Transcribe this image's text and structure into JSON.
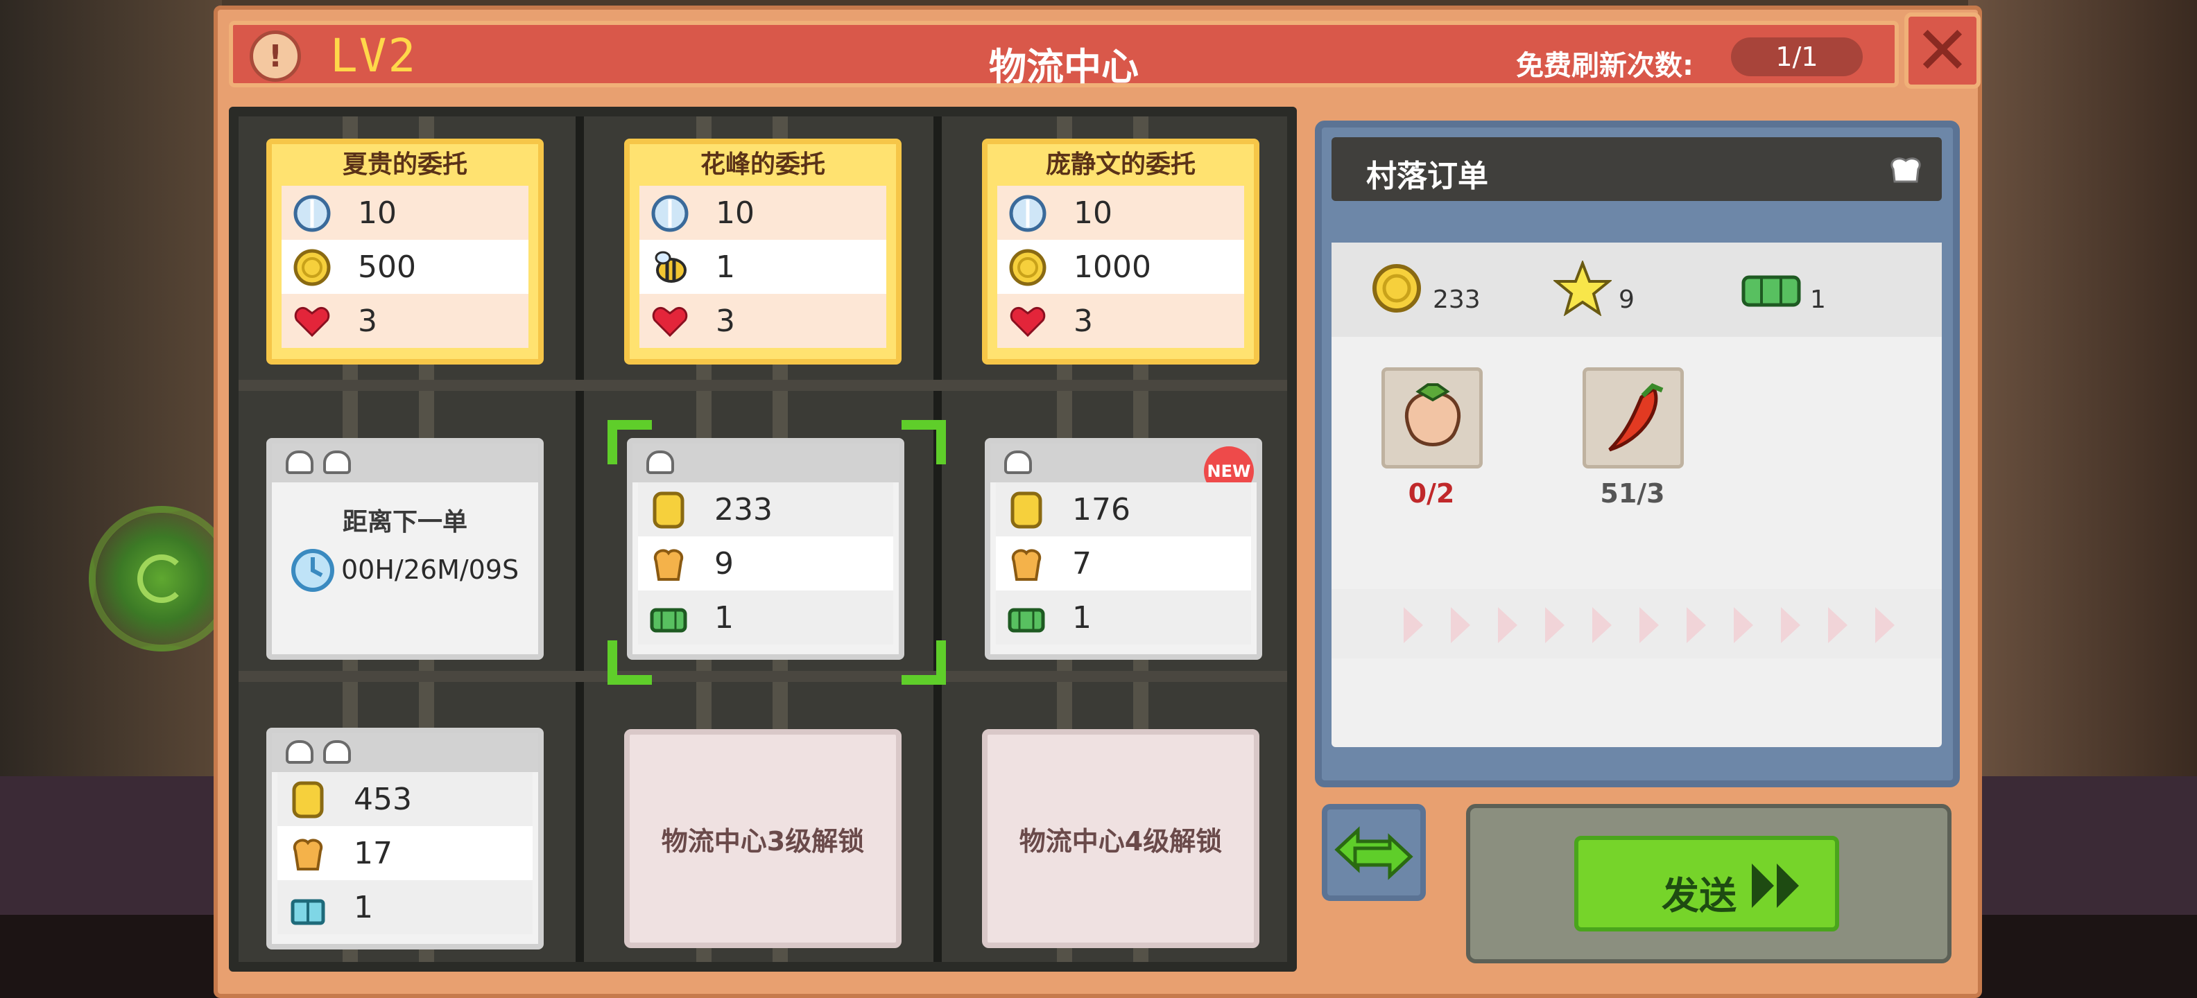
{
  "header": {
    "level": "LV2",
    "title": "物流中心",
    "refresh_label": "免费刷新次数:",
    "refresh_value": "1/1",
    "close_icon": "close-icon",
    "help_icon": "keyhole-icon"
  },
  "commissions": [
    {
      "name": "夏贵的委托",
      "rows": [
        {
          "icon": "crystal-icon",
          "value": "10"
        },
        {
          "icon": "coin-icon",
          "value": "500"
        },
        {
          "icon": "heart-icon",
          "value": "3"
        }
      ]
    },
    {
      "name": "花峰的委托",
      "rows": [
        {
          "icon": "crystal-icon",
          "value": "10"
        },
        {
          "icon": "bee-icon",
          "value": "1"
        },
        {
          "icon": "heart-icon",
          "value": "3"
        }
      ]
    },
    {
      "name": "庞静文的委托",
      "rows": [
        {
          "icon": "crystal-icon",
          "value": "10"
        },
        {
          "icon": "coin-icon",
          "value": "1000"
        },
        {
          "icon": "heart-icon",
          "value": "3"
        }
      ]
    }
  ],
  "waiting_order": {
    "label": "距离下一单",
    "timer": "00H/26M/09S"
  },
  "orders": [
    {
      "chefs": 1,
      "coin": "233",
      "exp": "9",
      "gem": "1",
      "selected": true
    },
    {
      "chefs": 1,
      "coin": "176",
      "exp": "7",
      "gem": "1",
      "badge": "NEW"
    },
    {
      "chefs": 2,
      "coin": "453",
      "exp": "17",
      "gem": "1"
    }
  ],
  "locked_slots": [
    "物流中心3级解锁",
    "物流中心4级解锁"
  ],
  "village_order": {
    "title": "村落订单",
    "rewards": {
      "coin": "233",
      "star": "9",
      "gem": "1"
    },
    "items": [
      {
        "icon": "strawberry-icon",
        "count": "0/2",
        "count_color": "#c0282a"
      },
      {
        "icon": "chili-pepper-icon",
        "count": "51/3",
        "count_color": "#555555"
      }
    ]
  },
  "actions": {
    "send_label": "发送",
    "swap_icon": "swap-icon"
  },
  "colors": {
    "title_bar": "#d9584a",
    "commission_card": "#ffe270",
    "send_button": "#76d42a",
    "board": "#3b3b36",
    "village_panel": "#6d87a8"
  }
}
